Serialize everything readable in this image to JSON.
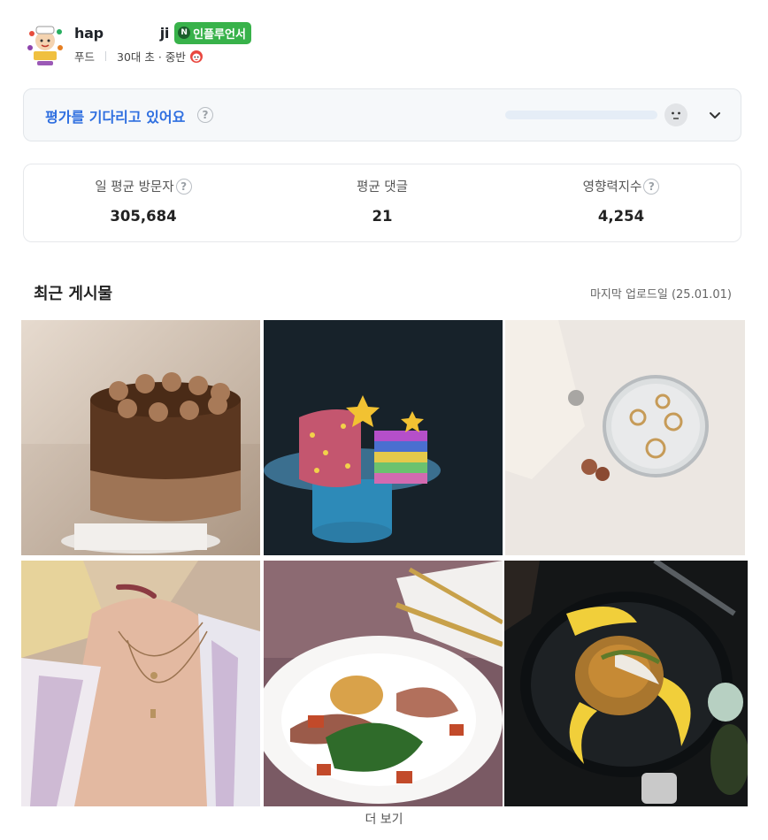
{
  "profile": {
    "name_start": "hap",
    "name_end": "ji",
    "badge": "인플루언서",
    "badge_icon": "N",
    "category": "푸드",
    "age": "30대 초 · 중반"
  },
  "evaluation": {
    "title": "평가를 기다리고 있어요",
    "help": "?"
  },
  "stats": [
    {
      "label": "일 평균 방문자",
      "value": "305,684",
      "has_help": true
    },
    {
      "label": "평균 댓글",
      "value": "21",
      "has_help": false
    },
    {
      "label": "영향력지수",
      "value": "4,254",
      "has_help": true
    }
  ],
  "recent": {
    "title": "최근 게시물",
    "last_upload": "마지막 업로드일 (25.01.01)",
    "more": "더 보기"
  },
  "colors": {
    "accent_blue": "#2f6fe0",
    "badge_green": "#38b24a"
  }
}
